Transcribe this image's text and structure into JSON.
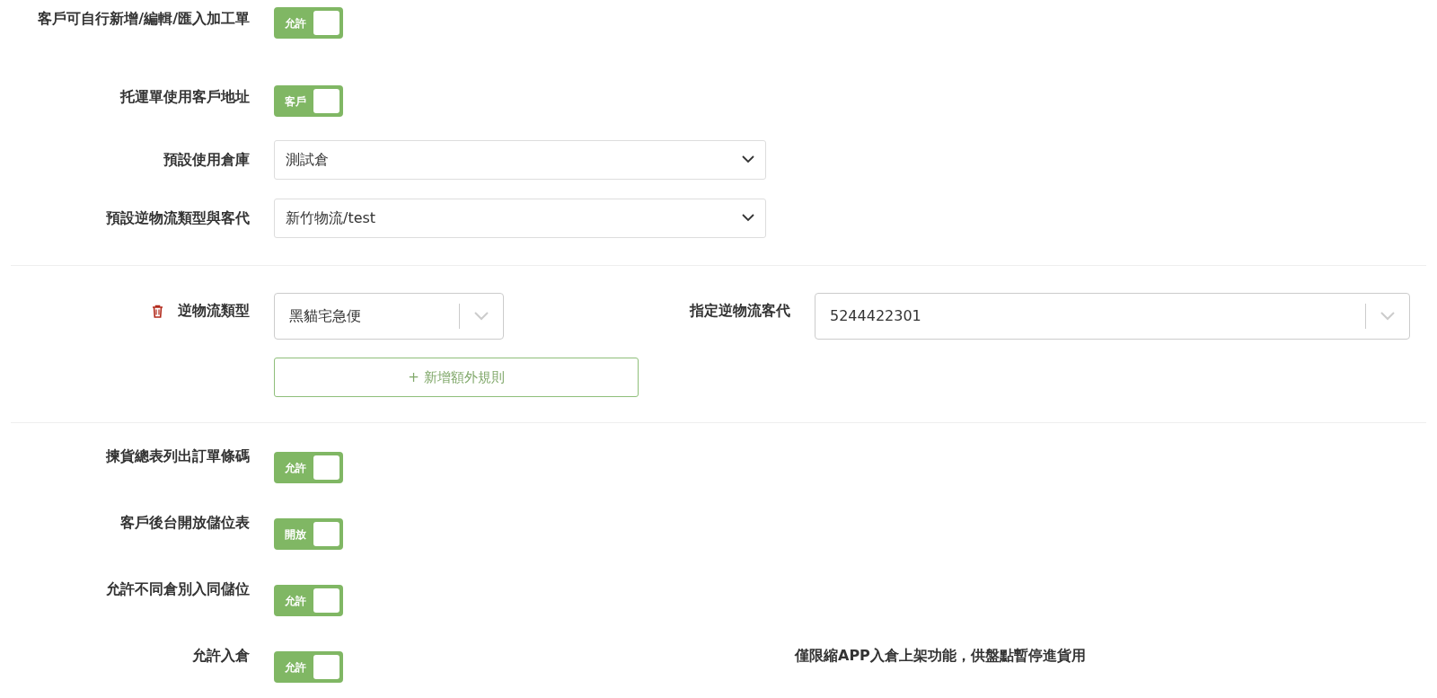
{
  "general_settings": [
    {
      "kind": "toggle",
      "label": "客戶可自行新增/編輯/匯入加工單",
      "on": true,
      "toggle_text": "允許"
    },
    {
      "kind": "toggle",
      "label": "托運單使用客戶地址",
      "on": true,
      "toggle_text": "客戶"
    },
    {
      "kind": "select",
      "label": "預設使用倉庫",
      "value": "測試倉"
    },
    {
      "kind": "select",
      "label": "預設逆物流類型與客代",
      "value": "新竹物流/test"
    }
  ],
  "reverse_rules": [
    {
      "type_label": "逆物流類型",
      "type_value": "黑貓宅急便",
      "agent_label": "指定逆物流客代",
      "agent_value": "5244422301"
    }
  ],
  "add_rule_button": "+ 新增額外規則",
  "warehouse_settings": [
    {
      "label": "揀貨總表列出訂單條碼",
      "on": true,
      "toggle_text": "允許"
    },
    {
      "label": "客戶後台開放儲位表",
      "on": true,
      "toggle_text": "開放"
    },
    {
      "label": "允許不同倉別入同儲位",
      "on": true,
      "toggle_text": "允許"
    },
    {
      "label": "允許入倉",
      "on": true,
      "toggle_text": "允許",
      "note": "僅限縮APP入倉上架功能，供盤點暫停進貨用"
    }
  ]
}
